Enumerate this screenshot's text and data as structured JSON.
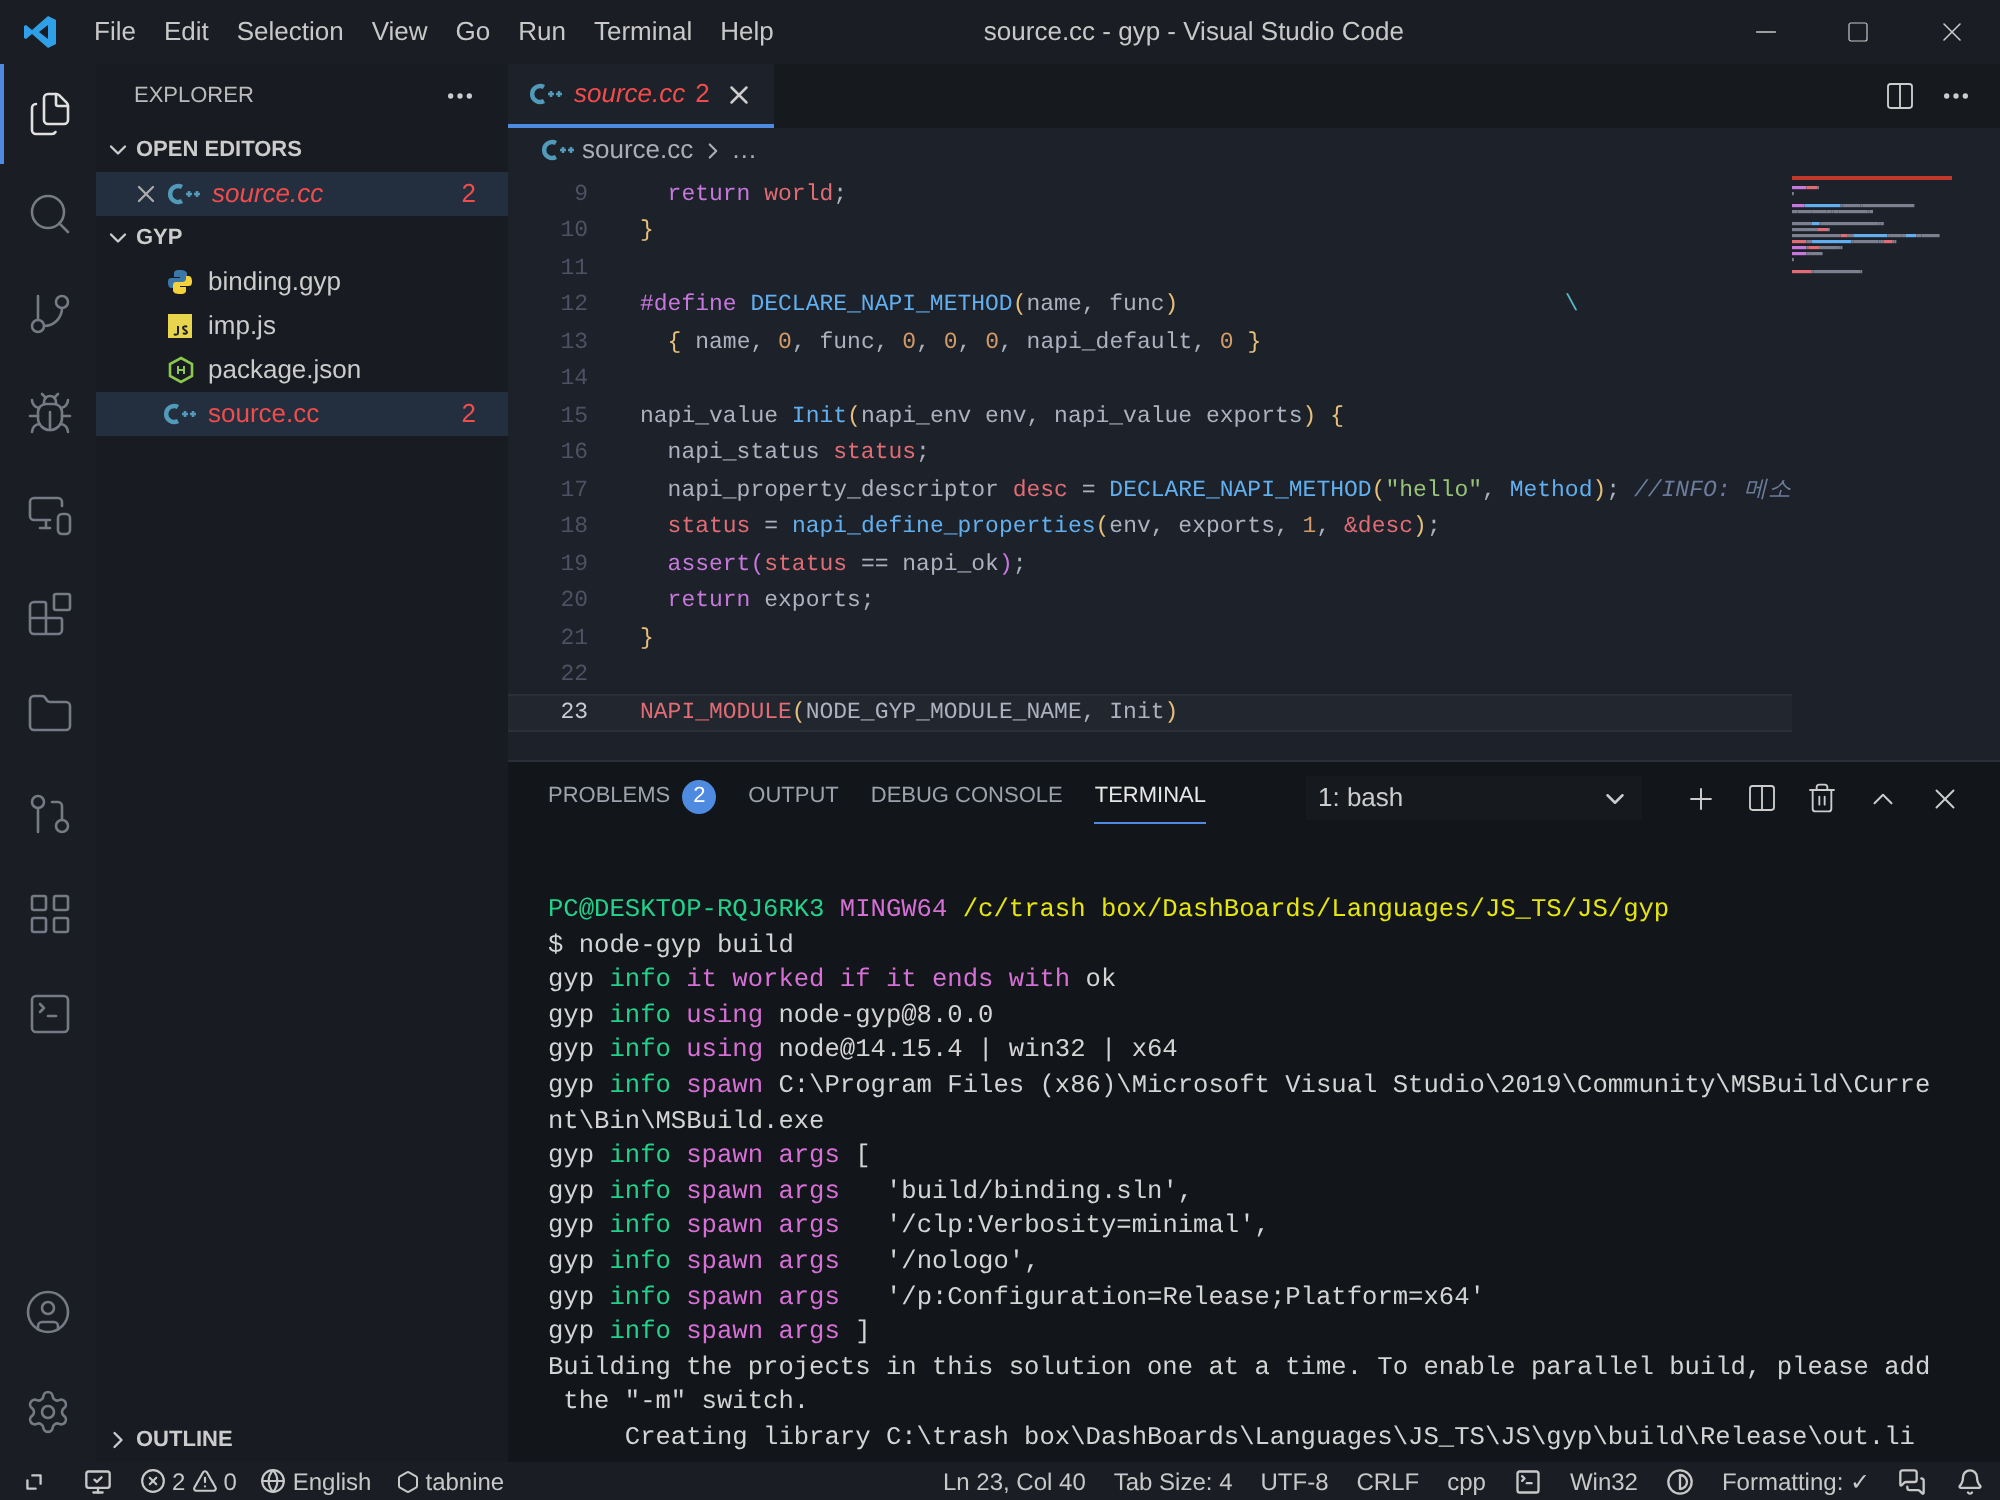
{
  "window": {
    "title": "source.cc - gyp - Visual Studio Code",
    "menu": [
      "File",
      "Edit",
      "Selection",
      "View",
      "Go",
      "Run",
      "Terminal",
      "Help"
    ]
  },
  "activity_bar": {
    "items": [
      {
        "kind": "explorer",
        "selected": true
      },
      {
        "kind": "search",
        "selected": false
      },
      {
        "kind": "source-control",
        "selected": false
      },
      {
        "kind": "debug",
        "selected": false
      },
      {
        "kind": "remote",
        "selected": false
      },
      {
        "kind": "extensions",
        "selected": false
      },
      {
        "kind": "folders",
        "selected": false
      },
      {
        "kind": "git-graph",
        "selected": false
      },
      {
        "kind": "grid",
        "selected": false
      },
      {
        "kind": "terminal",
        "selected": false
      }
    ],
    "bottom": [
      {
        "kind": "account"
      },
      {
        "kind": "settings"
      }
    ]
  },
  "sidebar": {
    "title": "EXPLORER",
    "sections": [
      {
        "title": "OPEN EDITORS",
        "expanded": true,
        "items": [
          {
            "name": "source.cc",
            "kind": "cpp",
            "badge": "2",
            "error": true,
            "italic": true,
            "selected": true,
            "closable": true
          }
        ]
      },
      {
        "title": "GYP",
        "expanded": true,
        "items": [
          {
            "name": "binding.gyp",
            "kind": "python",
            "error": false,
            "italic": false,
            "selected": false,
            "closable": false
          },
          {
            "name": "imp.js",
            "kind": "js",
            "error": false,
            "italic": false,
            "selected": false,
            "closable": false
          },
          {
            "name": "package.json",
            "kind": "node",
            "error": false,
            "italic": false,
            "selected": false,
            "closable": false
          },
          {
            "name": "source.cc",
            "kind": "cpp",
            "badge": "2",
            "error": true,
            "italic": false,
            "selected": true,
            "closable": false
          }
        ]
      },
      {
        "title": "OUTLINE",
        "expanded": false
      }
    ]
  },
  "editor": {
    "tabs": [
      {
        "label": "source.cc",
        "badge": "2",
        "error": true,
        "italic": true,
        "selected": true
      }
    ],
    "breadcrumb": {
      "file": "source.cc",
      "rest": "…"
    },
    "lines": [
      {
        "number": "9",
        "current": false,
        "tokens": [
          {
            "text": "  return",
            "kind": "keyword"
          },
          {
            "text": " world",
            "kind": "variable"
          },
          {
            "text": ";",
            "kind": "plain"
          }
        ]
      },
      {
        "number": "10",
        "current": false,
        "tokens": [
          {
            "text": "}",
            "kind": "bracket"
          }
        ]
      },
      {
        "number": "11",
        "current": false
      },
      {
        "number": "12",
        "current": false,
        "tokens": [
          {
            "text": "#define",
            "kind": "keyword"
          },
          {
            "text": " DECLARE_NAPI_METHOD",
            "kind": "function"
          },
          {
            "text": "(",
            "kind": "bracket"
          },
          {
            "text": "name, func",
            "kind": "plain"
          },
          {
            "text": ")",
            "kind": "bracket"
          },
          {
            "text": "                            \\",
            "kind": "escape"
          }
        ]
      },
      {
        "number": "13",
        "current": false,
        "tokens": [
          {
            "text": "  {",
            "kind": "bracket"
          },
          {
            "text": " name, ",
            "kind": "plain"
          },
          {
            "text": "0",
            "kind": "number"
          },
          {
            "text": ", func, ",
            "kind": "plain"
          },
          {
            "text": "0",
            "kind": "number"
          },
          {
            "text": ", ",
            "kind": "plain"
          },
          {
            "text": "0",
            "kind": "number"
          },
          {
            "text": ", ",
            "kind": "plain"
          },
          {
            "text": "0",
            "kind": "number"
          },
          {
            "text": ", napi_default, ",
            "kind": "plain"
          },
          {
            "text": "0",
            "kind": "number"
          },
          {
            "text": " }",
            "kind": "bracket"
          }
        ]
      },
      {
        "number": "14",
        "current": false
      },
      {
        "number": "15",
        "current": false,
        "tokens": [
          {
            "text": "napi_value ",
            "kind": "plain"
          },
          {
            "text": "Init",
            "kind": "function"
          },
          {
            "text": "(",
            "kind": "bracket"
          },
          {
            "text": "napi_env env, napi_value exports",
            "kind": "plain"
          },
          {
            "text": ")",
            "kind": "bracket"
          },
          {
            "text": " {",
            "kind": "bracket"
          }
        ]
      },
      {
        "number": "16",
        "current": false,
        "tokens": [
          {
            "text": "  napi_status ",
            "kind": "plain"
          },
          {
            "text": "status",
            "kind": "variable"
          },
          {
            "text": ";",
            "kind": "plain"
          }
        ]
      },
      {
        "number": "17",
        "current": false,
        "tokens": [
          {
            "text": "  napi_property_descriptor ",
            "kind": "plain"
          },
          {
            "text": "desc",
            "kind": "variable"
          },
          {
            "text": " = ",
            "kind": "plain"
          },
          {
            "text": "DECLARE_NAPI_METHOD",
            "kind": "function"
          },
          {
            "text": "(",
            "kind": "bracket"
          },
          {
            "text": "\"hello\"",
            "kind": "string"
          },
          {
            "text": ", ",
            "kind": "plain"
          },
          {
            "text": "Method",
            "kind": "function"
          },
          {
            "text": ")",
            "kind": "bracket"
          },
          {
            "text": "; ",
            "kind": "plain"
          },
          {
            "text": "//INFO: 메소",
            "kind": "comment"
          }
        ]
      },
      {
        "number": "18",
        "current": false,
        "tokens": [
          {
            "text": "  status",
            "kind": "variable"
          },
          {
            "text": " = ",
            "kind": "plain"
          },
          {
            "text": "napi_define_properties",
            "kind": "function"
          },
          {
            "text": "(",
            "kind": "bracket"
          },
          {
            "text": "env, exports, ",
            "kind": "plain"
          },
          {
            "text": "1",
            "kind": "number"
          },
          {
            "text": ", ",
            "kind": "plain"
          },
          {
            "text": "&desc",
            "kind": "variable"
          },
          {
            "text": ")",
            "kind": "bracket"
          },
          {
            "text": ";",
            "kind": "plain"
          }
        ]
      },
      {
        "number": "19",
        "current": false,
        "tokens": [
          {
            "text": "  assert",
            "kind": "keyword"
          },
          {
            "text": "(",
            "kind": "bracket2"
          },
          {
            "text": "status",
            "kind": "variable"
          },
          {
            "text": " == napi_ok",
            "kind": "plain"
          },
          {
            "text": ")",
            "kind": "bracket2"
          },
          {
            "text": ";",
            "kind": "plain"
          }
        ]
      },
      {
        "number": "20",
        "current": false,
        "tokens": [
          {
            "text": "  return",
            "kind": "keyword"
          },
          {
            "text": " exports;",
            "kind": "plain"
          }
        ]
      },
      {
        "number": "21",
        "current": false,
        "tokens": [
          {
            "text": "}",
            "kind": "bracket"
          }
        ]
      },
      {
        "number": "22",
        "current": false
      },
      {
        "number": "23",
        "current": true,
        "tokens": [
          {
            "text": "NAPI_MODULE",
            "kind": "variable"
          },
          {
            "text": "(",
            "kind": "bracket"
          },
          {
            "text": "NODE_GYP_MODULE_NAME, Init",
            "kind": "plain"
          },
          {
            "text": ")",
            "kind": "bracket"
          }
        ]
      }
    ]
  },
  "panel": {
    "tabs": [
      {
        "label": "PROBLEMS",
        "badge": "2",
        "selected": false
      },
      {
        "label": "OUTPUT",
        "selected": false
      },
      {
        "label": "DEBUG CONSOLE",
        "selected": false
      },
      {
        "label": "TERMINAL",
        "selected": true
      }
    ],
    "terminal_select": "1: bash",
    "terminal": [
      [
        {
          "text": "PC@DESKTOP-RQJ6RK3",
          "kind": "green"
        },
        {
          "text": " MINGW64",
          "kind": "magenta"
        },
        {
          "text": " /c/trash box/DashBoards/Languages/JS_TS/JS/gyp",
          "kind": "yellow"
        }
      ],
      [
        {
          "text": "$ node-gyp build",
          "kind": "plain"
        }
      ],
      [
        {
          "text": "gyp ",
          "kind": "plain"
        },
        {
          "text": "info",
          "kind": "green"
        },
        {
          "text": " it worked if it ends with",
          "kind": "magenta"
        },
        {
          "text": " ok",
          "kind": "plain"
        }
      ],
      [
        {
          "text": "gyp ",
          "kind": "plain"
        },
        {
          "text": "info",
          "kind": "green"
        },
        {
          "text": " using",
          "kind": "magenta"
        },
        {
          "text": " node-gyp@8.0.0",
          "kind": "plain"
        }
      ],
      [
        {
          "text": "gyp ",
          "kind": "plain"
        },
        {
          "text": "info",
          "kind": "green"
        },
        {
          "text": " using",
          "kind": "magenta"
        },
        {
          "text": " node@14.15.4 | win32 | x64",
          "kind": "plain"
        }
      ],
      [
        {
          "text": "gyp ",
          "kind": "plain"
        },
        {
          "text": "info",
          "kind": "green"
        },
        {
          "text": " spawn",
          "kind": "magenta"
        },
        {
          "text": " C:\\Program Files (x86)\\Microsoft Visual Studio\\2019\\Community\\MSBuild\\Curre",
          "kind": "plain"
        }
      ],
      [
        {
          "text": "nt\\Bin\\MSBuild.exe",
          "kind": "plain"
        }
      ],
      [
        {
          "text": "gyp ",
          "kind": "plain"
        },
        {
          "text": "info",
          "kind": "green"
        },
        {
          "text": " spawn args",
          "kind": "magenta"
        },
        {
          "text": " [",
          "kind": "plain"
        }
      ],
      [
        {
          "text": "gyp ",
          "kind": "plain"
        },
        {
          "text": "info",
          "kind": "green"
        },
        {
          "text": " spawn args",
          "kind": "magenta"
        },
        {
          "text": "   'build/binding.sln',",
          "kind": "plain"
        }
      ],
      [
        {
          "text": "gyp ",
          "kind": "plain"
        },
        {
          "text": "info",
          "kind": "green"
        },
        {
          "text": " spawn args",
          "kind": "magenta"
        },
        {
          "text": "   '/clp:Verbosity=minimal',",
          "kind": "plain"
        }
      ],
      [
        {
          "text": "gyp ",
          "kind": "plain"
        },
        {
          "text": "info",
          "kind": "green"
        },
        {
          "text": " spawn args",
          "kind": "magenta"
        },
        {
          "text": "   '/nologo',",
          "kind": "plain"
        }
      ],
      [
        {
          "text": "gyp ",
          "kind": "plain"
        },
        {
          "text": "info",
          "kind": "green"
        },
        {
          "text": " spawn args",
          "kind": "magenta"
        },
        {
          "text": "   '/p:Configuration=Release;Platform=x64'",
          "kind": "plain"
        }
      ],
      [
        {
          "text": "gyp ",
          "kind": "plain"
        },
        {
          "text": "info",
          "kind": "green"
        },
        {
          "text": " spawn args",
          "kind": "magenta"
        },
        {
          "text": " ]",
          "kind": "plain"
        }
      ],
      [
        {
          "text": "Building the projects in this solution one at a time. To enable parallel build, please add",
          "kind": "plain"
        }
      ],
      [
        {
          "text": " the \"-m\" switch.",
          "kind": "plain"
        }
      ],
      [
        {
          "text": "     Creating library C:\\trash box\\DashBoards\\Languages\\JS_TS\\JS\\gyp\\build\\Release\\out.li",
          "kind": "plain"
        }
      ]
    ]
  },
  "status_bar": {
    "left": [
      {
        "kind": "remote"
      },
      {
        "kind": "monitor"
      },
      {
        "kind": "problems",
        "errors": "2",
        "warnings": "0"
      },
      {
        "kind": "globe",
        "text": "English"
      },
      {
        "kind": "tabnine",
        "text": "tabnine"
      }
    ],
    "right": [
      {
        "kind": "text",
        "text": "Ln 23, Col 40"
      },
      {
        "kind": "text",
        "text": "Tab Size: 4"
      },
      {
        "kind": "text",
        "text": "UTF-8"
      },
      {
        "kind": "text",
        "text": "CRLF"
      },
      {
        "kind": "text",
        "text": "cpp"
      },
      {
        "kind": "terminal-icon"
      },
      {
        "kind": "text",
        "text": "Win32"
      },
      {
        "kind": "contrast-icon"
      },
      {
        "kind": "text",
        "text": "Formatting: ✓"
      },
      {
        "kind": "feedback-icon"
      },
      {
        "kind": "bell-icon"
      }
    ]
  }
}
